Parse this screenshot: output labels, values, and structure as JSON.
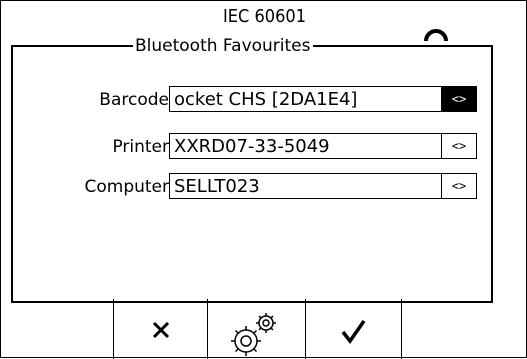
{
  "screen": {
    "title": "IEC 60601"
  },
  "dialog": {
    "title": "Bluetooth Favourites",
    "rows": [
      {
        "label": "Barcode",
        "value": "ocket CHS [2DA1E4]",
        "picker": "<>",
        "picker_selected": true
      },
      {
        "label": "Printer",
        "value": " XXRD07-33-5049",
        "picker": "<>",
        "picker_selected": false
      },
      {
        "label": "Computer",
        "value": "SELLT023",
        "picker": "<>",
        "picker_selected": false
      }
    ]
  },
  "softkeys": [
    {
      "icon": "close-icon"
    },
    {
      "icon": "gears-icon"
    },
    {
      "icon": "checkmark-icon"
    }
  ]
}
